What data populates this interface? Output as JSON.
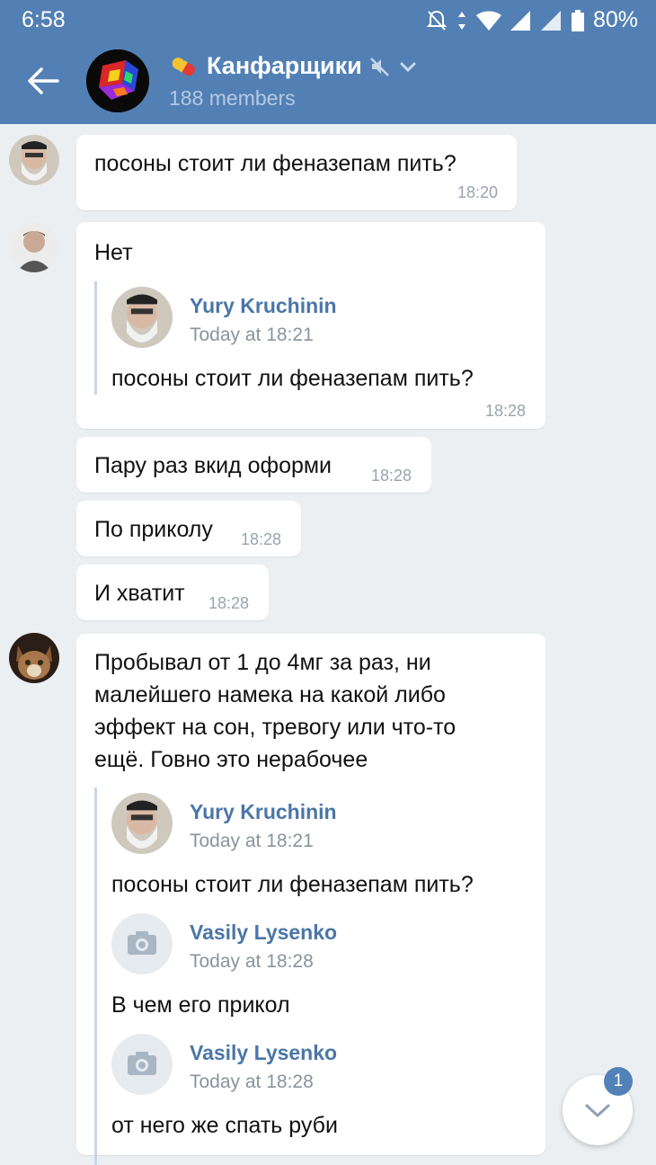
{
  "status_bar": {
    "time": "6:58",
    "battery": "80%"
  },
  "header": {
    "title": "Канфарщики",
    "members": "188 members"
  },
  "colors": {
    "header_bg": "#5280b4",
    "accent": "#4a76a8",
    "chat_bg": "#eceff2"
  },
  "messages": [
    {
      "text": "посоны стоит ли феназепам пить?",
      "time": "18:20"
    },
    {
      "text": "Нет",
      "time": "18:28",
      "reply": {
        "name": "Yury Kruchinin",
        "date": "Today at 18:21",
        "text": "посоны стоит ли феназепам пить?"
      }
    },
    {
      "text": "Пару раз вкид оформи",
      "time": "18:28"
    },
    {
      "text": "По приколу",
      "time": "18:28"
    },
    {
      "text": "И хватит",
      "time": "18:28"
    },
    {
      "lines": [
        "Пробывал от 1 до 4мг за раз, ни",
        "малейшего намека на какой либо",
        "эффект на сон, тревогу или что-то",
        "ещё. Говно это нерабочее"
      ],
      "replies": [
        {
          "name": "Yury Kruchinin",
          "date": "Today at 18:21",
          "text": "посоны стоит ли феназепам пить?"
        },
        {
          "name": "Vasily Lysenko",
          "date": "Today at 18:28",
          "text": "В чем его прикол"
        },
        {
          "name": "Vasily Lysenko",
          "date": "Today at 18:28",
          "text": "от него же спать руби"
        }
      ]
    }
  ],
  "unread_badge": "1"
}
